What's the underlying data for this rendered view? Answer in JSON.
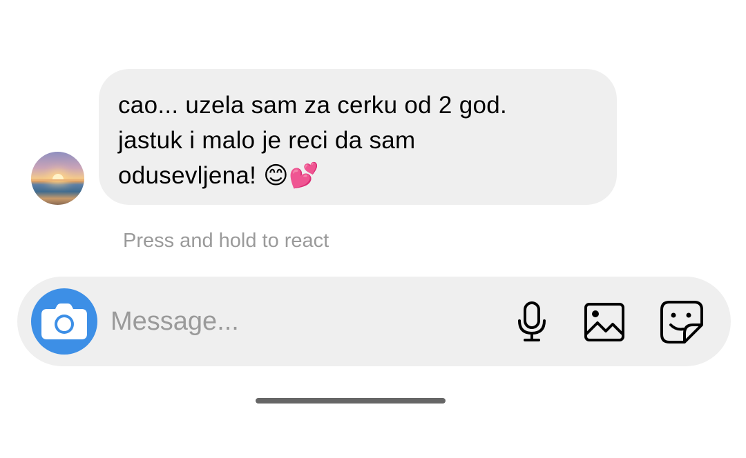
{
  "message": {
    "text": "cao... uzela sam za cerku od 2 god.\njastuk i malo je reci da sam\nodusevljena! 😊💕",
    "bubble_color": "#efefef"
  },
  "hint": {
    "text": "Press and hold to react"
  },
  "composer": {
    "placeholder": "Message...",
    "accent_color": "#3d8fe6",
    "icons": [
      "camera-icon",
      "microphone-icon",
      "image-gallery-icon",
      "sticker-icon"
    ]
  }
}
